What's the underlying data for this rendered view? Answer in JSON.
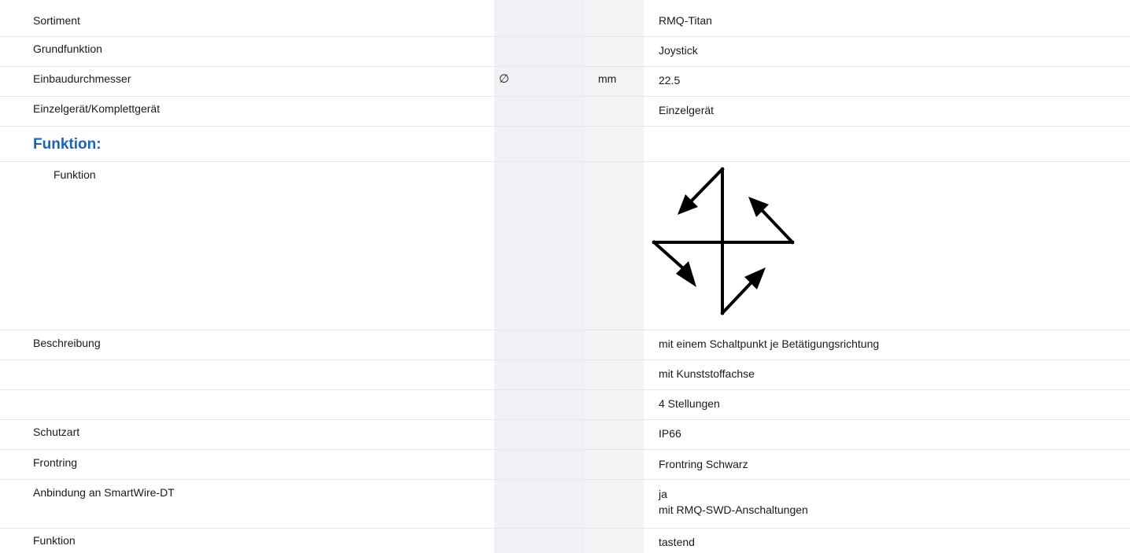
{
  "section_top": "",
  "rows": [
    {
      "label": "Sortiment",
      "symbol": "",
      "unit": "",
      "value": "RMQ-Titan"
    },
    {
      "label": "Grundfunktion",
      "symbol": "",
      "unit": "",
      "value": "Joystick"
    },
    {
      "label": "Einbaudurchmesser",
      "symbol": "∅",
      "unit": "mm",
      "value": "22.5"
    },
    {
      "label": "Einzelgerät/Komplettgerät",
      "symbol": "",
      "unit": "",
      "value": "Einzelgerät"
    }
  ],
  "section_funktion": "Funktion:",
  "funktion_row": {
    "label": "Funktion",
    "icon": "joystick-4-directions-icon"
  },
  "rows2": [
    {
      "label": "Beschreibung",
      "value": "mit einem Schaltpunkt je Betätigungsrichtung"
    },
    {
      "label": "",
      "value": "mit Kunststoffachse"
    },
    {
      "label": "",
      "value": "4 Stellungen"
    },
    {
      "label": "Schutzart",
      "value": "IP66"
    },
    {
      "label": "Frontring",
      "value": "Frontring Schwarz"
    },
    {
      "label": "Anbindung an SmartWire-DT",
      "value": "ja",
      "value2": "mit RMQ-SWD-Anschaltungen"
    },
    {
      "label": "Funktion",
      "value": "tastend"
    }
  ]
}
